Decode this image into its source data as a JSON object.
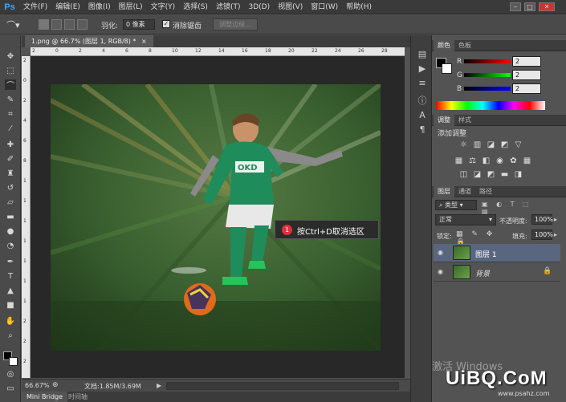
{
  "app": {
    "logo": "Ps"
  },
  "menu": [
    "文件(F)",
    "编辑(E)",
    "图像(I)",
    "图层(L)",
    "文字(Y)",
    "选择(S)",
    "滤镜(T)",
    "3D(D)",
    "视图(V)",
    "窗口(W)",
    "帮助(H)"
  ],
  "options": {
    "feather_label": "羽化:",
    "feather_value": "0 像素",
    "antialias_label": "消除锯齿",
    "refine_edge_label": "调整边缘..."
  },
  "document": {
    "tab_title": "1.png @ 66.7% (图层 1, RGB/8) *"
  },
  "ruler_h_ticks": [
    "2",
    "0",
    "2",
    "4",
    "6",
    "8",
    "10",
    "12",
    "14",
    "16",
    "18",
    "20",
    "22",
    "24",
    "26",
    "28"
  ],
  "ruler_v_ticks": [
    "2",
    "0",
    "2",
    "4",
    "6",
    "8",
    "1",
    "1",
    "1",
    "1",
    "1",
    "1",
    "1",
    "2",
    "2",
    "2"
  ],
  "photo": {
    "jersey_text": "OKD"
  },
  "annotation": {
    "badge": "1",
    "text": "按Ctrl+D取消选区"
  },
  "status": {
    "zoom": "66.67%",
    "doc_info": "文档:1.85M/3.69M"
  },
  "bottom_tabs": [
    "Mini Bridge",
    "时间轴"
  ],
  "color_panel": {
    "tabs": [
      "颜色",
      "色板"
    ],
    "r_label": "R",
    "g_label": "G",
    "b_label": "B",
    "r_value": "2",
    "g_value": "2",
    "b_value": "2"
  },
  "adjust_panel": {
    "tabs": [
      "调整",
      "样式"
    ],
    "heading": "添加调整"
  },
  "layers_panel": {
    "tabs": [
      "图层",
      "通道",
      "路径"
    ],
    "filter_kind": "类型",
    "blend_mode": "正常",
    "opacity_label": "不透明度:",
    "opacity_value": "100%",
    "lock_label": "锁定:",
    "fill_label": "填充:",
    "fill_value": "100%",
    "layers": [
      {
        "name": "图层 1"
      },
      {
        "name": "背景"
      }
    ]
  },
  "watermark": {
    "line1": "激活 Windows",
    "logo": "UiBQ.CoM",
    "url": "www.psahz.com"
  },
  "colors": {
    "accent_blue": "#3fa8f5",
    "selected_layer": "#58677f",
    "badge_red": "#e0303a"
  }
}
